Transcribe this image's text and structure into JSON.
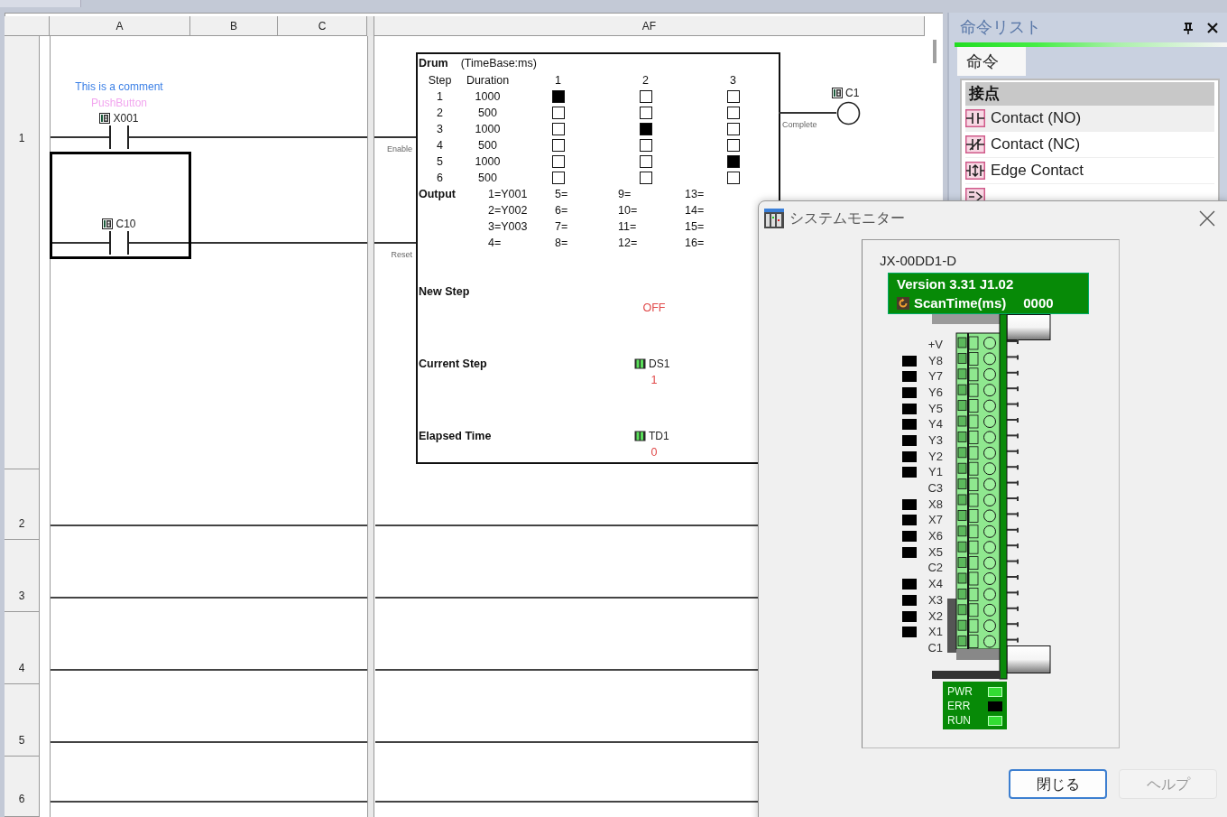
{
  "editor": {
    "columns": [
      {
        "label": "A"
      },
      {
        "label": "B"
      },
      {
        "label": "C"
      },
      {
        "label": "AF"
      }
    ],
    "rows": [
      "1",
      "2",
      "3",
      "4",
      "5",
      "6"
    ],
    "rungs": [
      {
        "comment": "This is a comment",
        "nickname": "PushButton",
        "address": "X001",
        "selected": false
      },
      {
        "address": "C10",
        "selected": true
      }
    ],
    "drum": {
      "title": "Drum",
      "timebase": "(TimeBase:ms)",
      "step_header": "Step",
      "duration_header": "Duration",
      "output_columns": [
        "1",
        "2",
        "3"
      ],
      "steps": [
        {
          "step": "1",
          "duration": "1000",
          "outputs": [
            true,
            false,
            false
          ]
        },
        {
          "step": "2",
          "duration": "500",
          "outputs": [
            false,
            false,
            false
          ]
        },
        {
          "step": "3",
          "duration": "1000",
          "outputs": [
            false,
            true,
            false
          ]
        },
        {
          "step": "4",
          "duration": "500",
          "outputs": [
            false,
            false,
            false
          ]
        },
        {
          "step": "5",
          "duration": "1000",
          "outputs": [
            false,
            false,
            true
          ]
        },
        {
          "step": "6",
          "duration": "500",
          "outputs": [
            false,
            false,
            false
          ]
        }
      ],
      "output_label": "Output",
      "output_map": [
        "1=Y001",
        "2=Y002",
        "3=Y003",
        "4=",
        "5=",
        "6=",
        "7=",
        "8=",
        "9=",
        "10=",
        "11=",
        "12=",
        "13=",
        "14=",
        "15=",
        "16="
      ],
      "inputs": [
        {
          "label": "Enable"
        },
        {
          "label": "Reset"
        }
      ],
      "result": {
        "label": "Complete",
        "address": "C1"
      },
      "fields": [
        {
          "label": "New Step",
          "value": "OFF"
        },
        {
          "label": "Current Step",
          "address": "DS1",
          "value": "1"
        },
        {
          "label": "Elapsed Time",
          "address": "TD1",
          "value": "0"
        }
      ]
    }
  },
  "instruction_list": {
    "title": "命令リスト",
    "tabs": [
      {
        "label": "命令",
        "selected": true
      }
    ],
    "group": "接点",
    "items": [
      {
        "label": "Contact (NO)",
        "kind": "open",
        "selected": true
      },
      {
        "label": "Contact (NC)",
        "kind": "closed",
        "selected": false
      },
      {
        "label": "Edge Contact",
        "kind": "edge",
        "selected": false
      },
      {
        "kind": "compare",
        "selected": false
      }
    ]
  },
  "system_monitor": {
    "title": "システムモニター",
    "model": "JX-00DD1-D",
    "version": "Version 3.31 J1.02",
    "scan_label": "ScanTime(ms)",
    "scan_value": "0000",
    "terminals": [
      {
        "label": "+V",
        "kind": "common"
      },
      {
        "label": "Y8",
        "kind": "io",
        "on": false
      },
      {
        "label": "Y7",
        "kind": "io",
        "on": false
      },
      {
        "label": "Y6",
        "kind": "io",
        "on": false
      },
      {
        "label": "Y5",
        "kind": "io",
        "on": false
      },
      {
        "label": "Y4",
        "kind": "io",
        "on": false
      },
      {
        "label": "Y3",
        "kind": "io",
        "on": false
      },
      {
        "label": "Y2",
        "kind": "io",
        "on": false
      },
      {
        "label": "Y1",
        "kind": "io",
        "on": false
      },
      {
        "label": "C3",
        "kind": "common"
      },
      {
        "label": "X8",
        "kind": "io",
        "on": false
      },
      {
        "label": "X7",
        "kind": "io",
        "on": false
      },
      {
        "label": "X6",
        "kind": "io",
        "on": false
      },
      {
        "label": "X5",
        "kind": "io",
        "on": false
      },
      {
        "label": "C2",
        "kind": "common"
      },
      {
        "label": "X4",
        "kind": "io",
        "on": false
      },
      {
        "label": "X3",
        "kind": "io",
        "on": false
      },
      {
        "label": "X2",
        "kind": "io",
        "on": false
      },
      {
        "label": "X1",
        "kind": "io",
        "on": false
      },
      {
        "label": "C1",
        "kind": "common"
      }
    ],
    "leds": [
      {
        "label": "PWR",
        "on": true
      },
      {
        "label": "ERR",
        "on": false
      },
      {
        "label": "RUN",
        "on": true
      }
    ],
    "buttons": [
      {
        "label": "閉じる",
        "default": true,
        "disabled": false
      },
      {
        "label": "ヘルプ",
        "default": false,
        "disabled": true
      }
    ]
  }
}
